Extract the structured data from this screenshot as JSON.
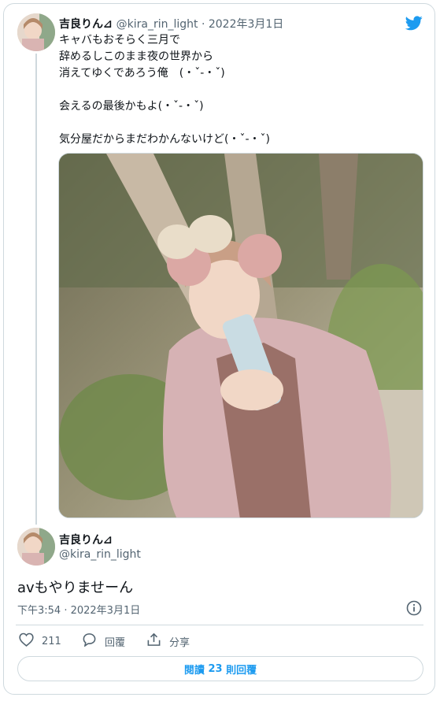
{
  "first_tweet": {
    "display_name": "吉良りん⊿",
    "handle": "@kira_rin_light",
    "separator": " · ",
    "date": "2022年3月1日",
    "text": "キャバもおそらく三月で\n辞めるしこのまま夜の世界から\n消えてゆくであろう俺　(・ˇ-・ˇ)\n\n会えるの最後かもよ(・ˇ-・ˇ)\n\n気分屋だからまだわかんないけど(・ˇ-・ˇ)"
  },
  "reply_tweet": {
    "display_name": "吉良りん⊿",
    "handle": "@kira_rin_light",
    "text": "avもやりませーん",
    "timestamp": "下午3:54 · 2022年3月1日"
  },
  "actions": {
    "like_count": "211",
    "reply_label": "回覆",
    "share_label": "分享"
  },
  "read_replies": {
    "prefix": "閱讀 ",
    "count": "23",
    "suffix": " 則回覆"
  },
  "colors": {
    "twitter_blue": "#1d9bf0",
    "border": "#cfd9de",
    "muted_text": "#536471"
  },
  "icons": [
    "twitter-bird-icon",
    "info-icon",
    "heart-icon",
    "reply-icon",
    "share-icon"
  ]
}
